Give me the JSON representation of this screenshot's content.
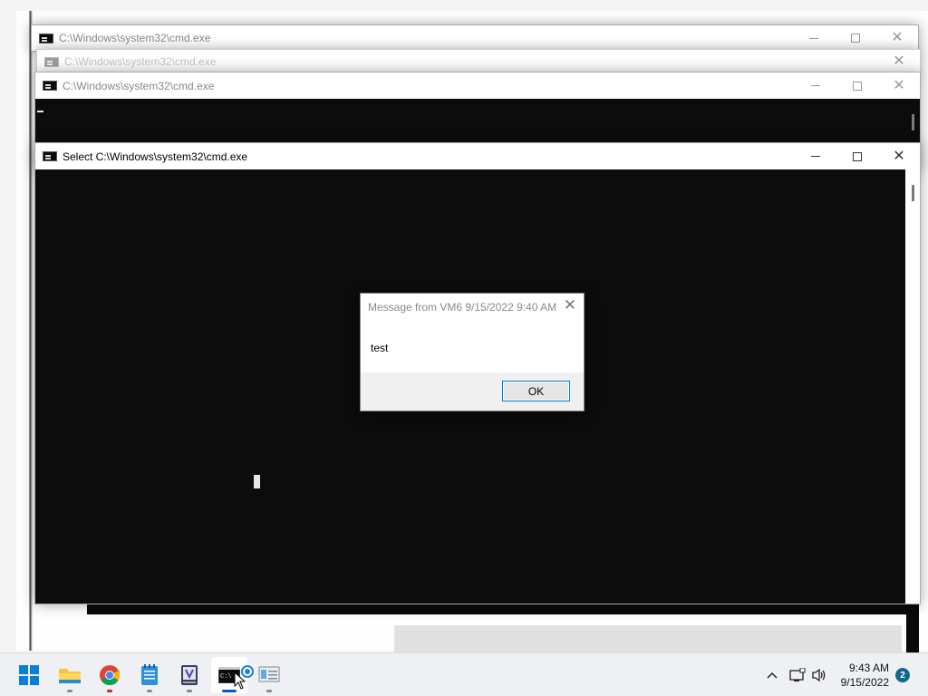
{
  "windows": {
    "back1_title": "C:\\Windows\\system32\\cmd.exe",
    "back2_title": "C:\\Windows\\system32\\cmd.exe",
    "middle_title": "C:\\Windows\\system32\\cmd.exe",
    "front_title": "Select C:\\Windows\\system32\\cmd.exe"
  },
  "dialog": {
    "title": "Message from VM6 9/15/2022 9:40 AM",
    "message": "test",
    "ok_label": "OK"
  },
  "taskbar": {
    "apps": [
      {
        "icon": "windows-start-icon"
      },
      {
        "icon": "file-explorer-icon"
      },
      {
        "icon": "chrome-icon"
      },
      {
        "icon": "notepad-icon"
      },
      {
        "icon": "visual-studio-icon"
      },
      {
        "icon": "cmd-icon",
        "active": true
      },
      {
        "icon": "remote-desktop-icon"
      }
    ],
    "clock_time": "9:43 AM",
    "clock_date": "9/15/2022",
    "notification_count": "2"
  },
  "colors": {
    "terminal_bg": "#0c0c0c",
    "accent": "#0078d4",
    "taskbar_bg": "#eef0f3"
  }
}
